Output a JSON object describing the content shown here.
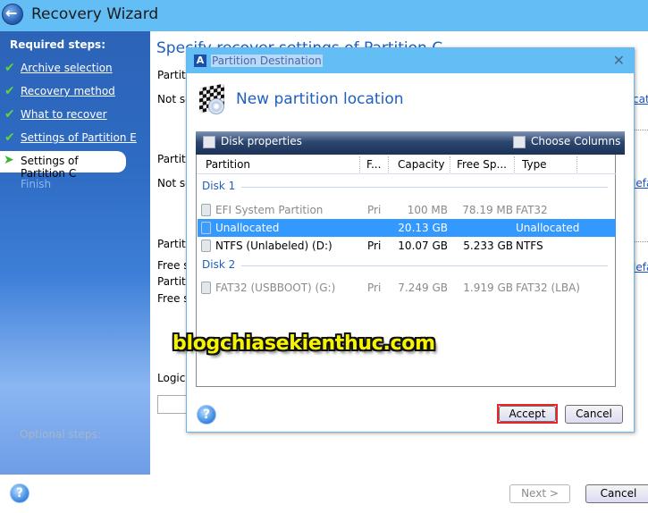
{
  "window": {
    "title": "Recovery Wizard"
  },
  "sidebar": {
    "required_heading": "Required steps:",
    "steps": [
      {
        "label": "Archive selection",
        "state": "done"
      },
      {
        "label": "Recovery method",
        "state": "done"
      },
      {
        "label": "What to recover",
        "state": "done"
      },
      {
        "label": "Settings of Partition E",
        "state": "done"
      },
      {
        "label": "Settings of Partition C",
        "state": "current"
      },
      {
        "label": "Finish",
        "state": "disabled"
      }
    ],
    "optional_heading": "Optional steps:"
  },
  "main": {
    "title": "Specify recover settings of Partition C",
    "lines": [
      {
        "text": "Partiti"
      },
      {
        "text": "Not se"
      },
      {
        "text": "Partiti"
      },
      {
        "text": "Not se"
      },
      {
        "text": "Partiti"
      },
      {
        "text": "Free sp"
      },
      {
        "text": "Partiti"
      },
      {
        "text": "Free sp"
      },
      {
        "text": "Logica"
      }
    ],
    "links": [
      "cati",
      "lefa",
      "lefa"
    ],
    "next_label": "Next >",
    "cancel_label": "Cancel"
  },
  "dialog": {
    "title": "Partition Destination",
    "heading": "New partition location",
    "toolbar": {
      "disk_properties": "Disk properties",
      "choose_columns": "Choose Columns"
    },
    "columns": [
      "Partition",
      "F...",
      "Capacity",
      "Free Sp...",
      "Type"
    ],
    "groups": [
      {
        "label": "Disk 1",
        "rows": [
          {
            "partition": "EFI System Partition",
            "flags": "Pri",
            "capacity": "100 MB",
            "free": "78.19 MB",
            "type": "FAT32",
            "state": "dim"
          },
          {
            "partition": "Unallocated",
            "flags": "",
            "capacity": "20.13 GB",
            "free": "",
            "type": "Unallocated",
            "state": "selected"
          },
          {
            "partition": "NTFS (Unlabeled) (D:)",
            "flags": "Pri",
            "capacity": "10.07 GB",
            "free": "5.233 GB",
            "type": "NTFS",
            "state": "normal"
          }
        ]
      },
      {
        "label": "Disk 2",
        "rows": [
          {
            "partition": "FAT32 (USBBOOT) (G:)",
            "flags": "Pri",
            "capacity": "7.249 GB",
            "free": "1.919 GB",
            "type": "FAT32 (LBA)",
            "state": "dim"
          }
        ]
      }
    ],
    "accept_label": "Accept",
    "cancel_label": "Cancel"
  },
  "watermark": "blogchiasekienthuc.com",
  "colors": {
    "titlebar": "#63bef5",
    "accent_blue": "#1f5fc0",
    "selection": "#3399ff",
    "highlight_frame": "#e8262a",
    "watermark_fill": "#f7f400"
  }
}
